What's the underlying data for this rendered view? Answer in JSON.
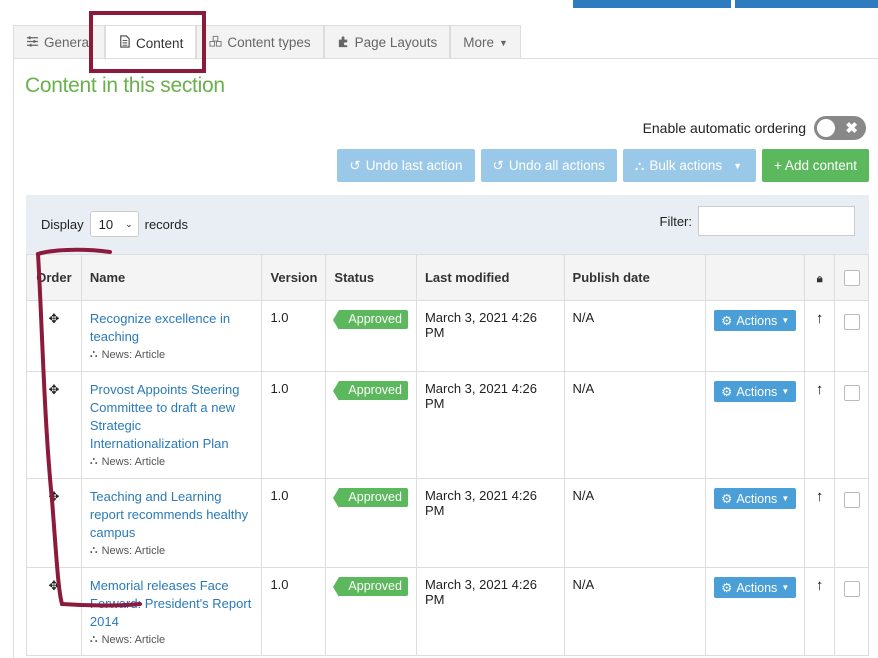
{
  "tabs": [
    {
      "label": "General",
      "icon": "sliders-icon"
    },
    {
      "label": "Content",
      "icon": "document-icon",
      "active": true
    },
    {
      "label": "Content types",
      "icon": "cubes-icon"
    },
    {
      "label": "Page Layouts",
      "icon": "puzzle-icon"
    },
    {
      "label": "More",
      "icon": "caret-down-icon"
    }
  ],
  "section_title": "Content in this section",
  "auto_ordering": {
    "label": "Enable automatic ordering",
    "enabled": false
  },
  "toolbar": {
    "undo_last": "Undo last action",
    "undo_all": "Undo all actions",
    "bulk": "Bulk actions",
    "add": "+ Add content"
  },
  "display": {
    "prefix": "Display",
    "value": "10",
    "suffix": "records"
  },
  "filter": {
    "label": "Filter:",
    "value": ""
  },
  "table": {
    "headers": {
      "order": "Order",
      "name": "Name",
      "version": "Version",
      "status": "Status",
      "modified": "Last modified",
      "publish": "Publish date"
    },
    "rows": [
      {
        "name": "Recognize excellence in teaching",
        "type": "News: Article",
        "version": "1.0",
        "status": "Approved",
        "modified": "March 3, 2021 4:26 PM",
        "publish": "N/A",
        "actions": "Actions"
      },
      {
        "name": "Provost Appoints Steering Committee to draft a new Strategic Internationalization Plan",
        "type": "News: Article",
        "version": "1.0",
        "status": "Approved",
        "modified": "March 3, 2021 4:26 PM",
        "publish": "N/A",
        "actions": "Actions"
      },
      {
        "name": "Teaching and Learning report recommends healthy campus",
        "type": "News: Article",
        "version": "1.0",
        "status": "Approved",
        "modified": "March 3, 2021 4:26 PM",
        "publish": "N/A",
        "actions": "Actions"
      },
      {
        "name": "Memorial releases Face Forward: President's Report 2014",
        "type": "News: Article",
        "version": "1.0",
        "status": "Approved",
        "modified": "March 3, 2021 4:26 PM",
        "publish": "N/A",
        "actions": "Actions"
      }
    ]
  },
  "colors": {
    "accent": "#2a7ab8",
    "section_title": "#6ab04c",
    "approved": "#5cb85c",
    "annotation": "#8b1a3d"
  }
}
